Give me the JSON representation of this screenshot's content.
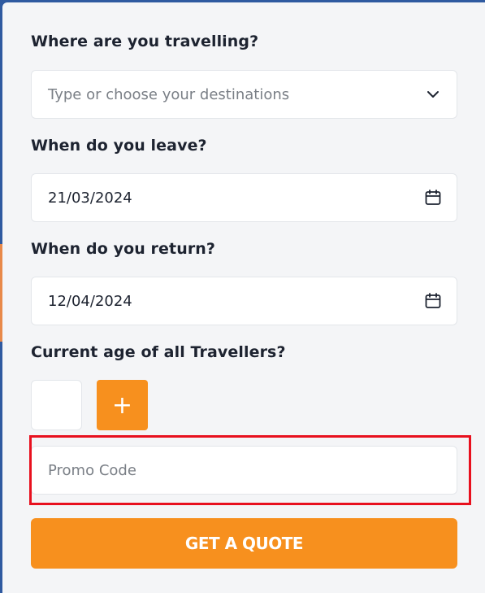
{
  "form": {
    "destination": {
      "label": "Where are you travelling?",
      "placeholder": "Type or choose your destinations",
      "icon": "chevron-down-icon"
    },
    "leave": {
      "label": "When do you leave?",
      "value": "21/03/2024",
      "icon": "calendar-icon"
    },
    "return": {
      "label": "When do you return?",
      "value": "12/04/2024",
      "icon": "calendar-icon"
    },
    "travellers": {
      "label": "Current age of all Travellers?",
      "age_value": "",
      "add_symbol": "+"
    },
    "promo": {
      "placeholder": "Promo Code"
    },
    "submit_label": "GET A QUOTE"
  },
  "colors": {
    "accent": "#f7901e",
    "highlight": "#e8101e",
    "panel_bg": "#f4f5f7",
    "backdrop": "#2f5aa0"
  }
}
